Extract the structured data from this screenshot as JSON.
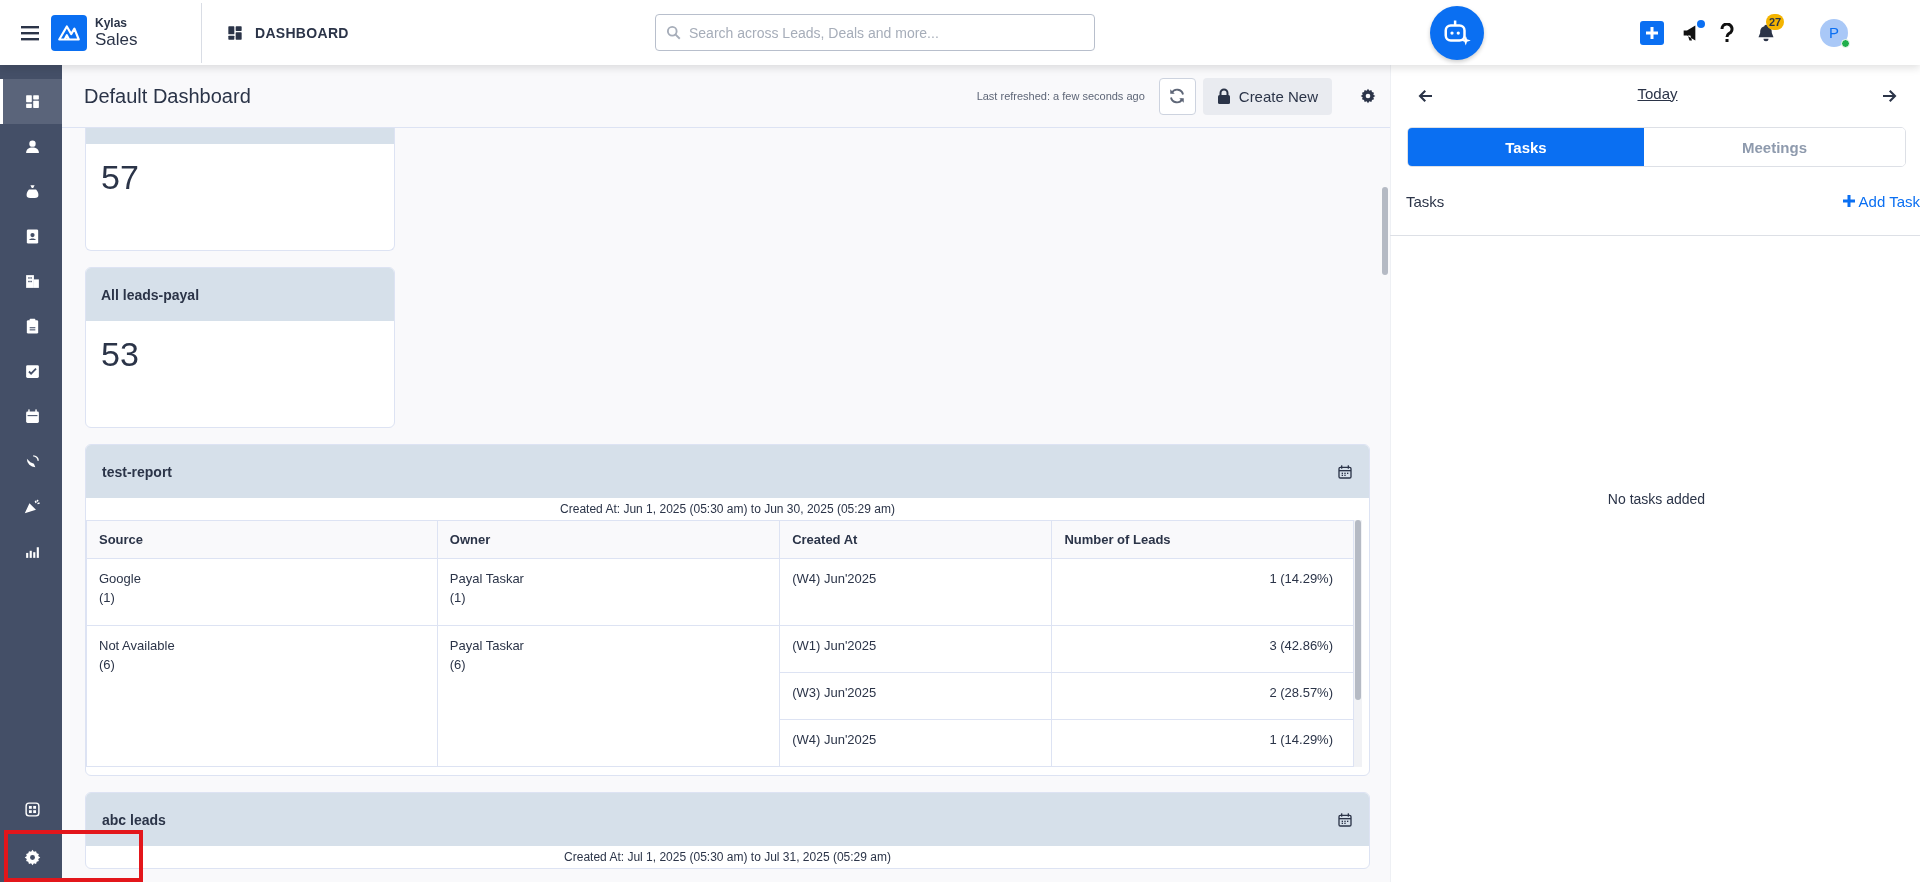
{
  "app": {
    "brand_top": "Kylas",
    "brand_bottom": "Sales",
    "module": "DASHBOARD"
  },
  "search": {
    "placeholder": "Search across Leads, Deals and more..."
  },
  "notifications": {
    "count": "27",
    "announcement_unread": true
  },
  "avatar": {
    "initial": "P",
    "online": true
  },
  "sidebar": {
    "items": [
      {
        "selected": true
      },
      {
        "selected": false
      },
      {
        "selected": false
      },
      {
        "selected": false
      },
      {
        "selected": false
      },
      {
        "selected": false
      },
      {
        "selected": false
      },
      {
        "selected": false
      },
      {
        "selected": false
      },
      {
        "selected": false
      },
      {
        "selected": false
      }
    ],
    "bottom_items": [
      {
        "selected": false
      },
      {
        "selected": false,
        "highlighted": true
      }
    ]
  },
  "dashboard": {
    "title": "Default Dashboard",
    "last_refreshed": "Last refreshed: a few seconds ago",
    "create_button": "Create New",
    "cards": [
      {
        "value": "57"
      },
      {
        "title": "All leads-payal",
        "value": "53"
      }
    ],
    "reports": [
      {
        "title": "test-report",
        "range": "Created At: Jun 1, 2025 (05:30 am) to Jun 30, 2025 (05:29 am)",
        "columns": [
          "Source",
          "Owner",
          "Created At",
          "Number of Leads"
        ],
        "groups": [
          {
            "source": "Google",
            "source_count": "(1)",
            "owner": "Payal Taskar",
            "owner_count": "(1)",
            "entries": [
              {
                "created_at": "(W4) Jun'2025",
                "leads": "1 (14.29%)"
              }
            ]
          },
          {
            "source": "Not Available",
            "source_count": "(6)",
            "owner": "Payal Taskar",
            "owner_count": "(6)",
            "entries": [
              {
                "created_at": "(W1) Jun'2025",
                "leads": "3 (42.86%)"
              },
              {
                "created_at": "(W3) Jun'2025",
                "leads": "2 (28.57%)"
              },
              {
                "created_at": "(W4) Jun'2025",
                "leads": "1 (14.29%)"
              }
            ]
          }
        ]
      },
      {
        "title": "abc leads",
        "range": "Created At: Jul 1, 2025 (05:30 am) to Jul 31, 2025 (05:29 am)"
      }
    ]
  },
  "agenda": {
    "date": "Today",
    "tabs": [
      {
        "label": "Tasks",
        "selected": true
      },
      {
        "label": "Meetings",
        "selected": false
      }
    ],
    "section": "Tasks",
    "add_button": "Add Task",
    "empty": "No tasks added"
  }
}
